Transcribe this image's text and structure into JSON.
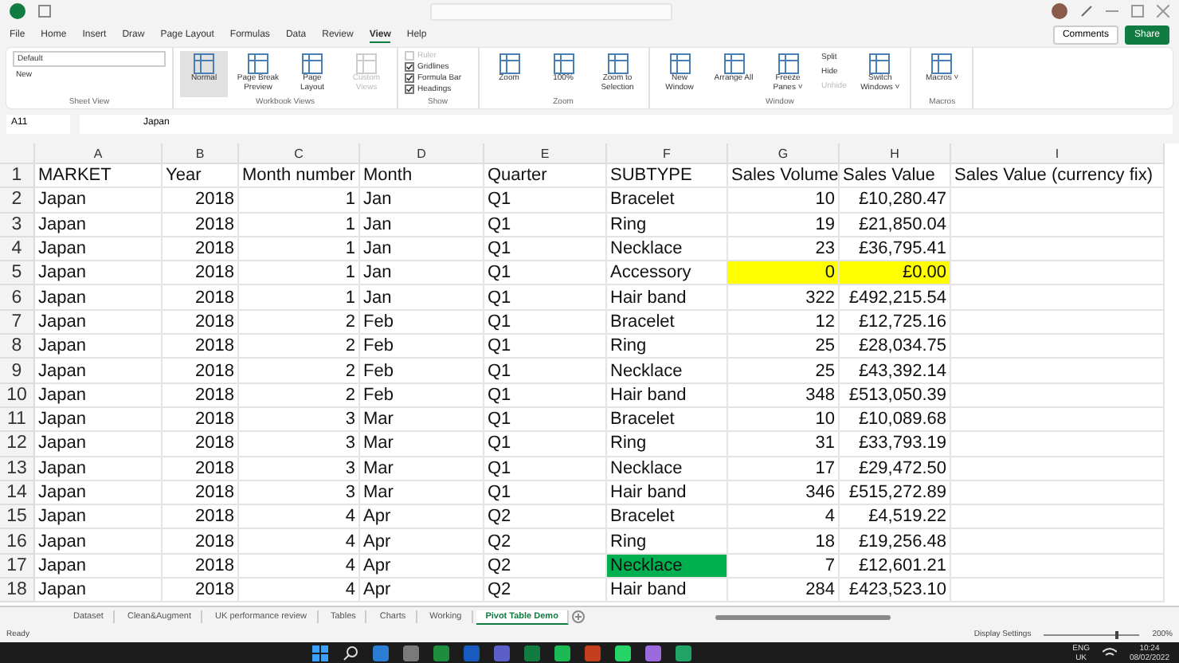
{
  "ribbon_tabs": [
    {
      "label": "File",
      "selected": false
    },
    {
      "label": "Home",
      "selected": false
    },
    {
      "label": "Insert",
      "selected": false
    },
    {
      "label": "Draw",
      "selected": false
    },
    {
      "label": "Page Layout",
      "selected": false
    },
    {
      "label": "Formulas",
      "selected": false
    },
    {
      "label": "Data",
      "selected": false
    },
    {
      "label": "Review",
      "selected": false
    },
    {
      "label": "View",
      "selected": true
    },
    {
      "label": "Help",
      "selected": false
    }
  ],
  "header_buttons": {
    "comments": "Comments",
    "share": "Share"
  },
  "ribbon_groups": [
    {
      "label": "Sheet View",
      "items": [
        {
          "kind": "dropdown",
          "label": "Default",
          "disabled": false
        },
        {
          "kind": "small",
          "label": "New",
          "disabled": false
        }
      ]
    },
    {
      "label": "Workbook Views",
      "items": [
        {
          "kind": "large",
          "label": "Normal",
          "disabled": false,
          "selected": true
        },
        {
          "kind": "large",
          "label": "Page Break Preview",
          "disabled": false,
          "selected": false
        },
        {
          "kind": "large",
          "label": "Page Layout",
          "disabled": false,
          "selected": false
        },
        {
          "kind": "large",
          "label": "Custom Views",
          "disabled": true,
          "selected": false
        }
      ]
    },
    {
      "label": "Show",
      "items": [
        {
          "kind": "check",
          "label": "Ruler",
          "disabled": true,
          "checked": false
        },
        {
          "kind": "check",
          "label": "Gridlines",
          "disabled": false,
          "checked": true
        },
        {
          "kind": "check",
          "label": "Formula Bar",
          "disabled": false,
          "checked": true
        },
        {
          "kind": "check",
          "label": "Headings",
          "disabled": false,
          "checked": true
        }
      ]
    },
    {
      "label": "Zoom",
      "items": [
        {
          "kind": "large",
          "label": "Zoom",
          "disabled": false,
          "selected": false
        },
        {
          "kind": "large",
          "label": "100%",
          "disabled": false,
          "selected": false
        },
        {
          "kind": "large",
          "label": "Zoom to Selection",
          "disabled": false,
          "selected": false
        }
      ]
    },
    {
      "label": "Window",
      "items": [
        {
          "kind": "large",
          "label": "New Window",
          "disabled": false,
          "selected": false
        },
        {
          "kind": "large",
          "label": "Arrange All",
          "disabled": false,
          "selected": false
        },
        {
          "kind": "large",
          "label": "Freeze Panes ˅",
          "disabled": false,
          "selected": false
        },
        {
          "kind": "small",
          "label": "Split",
          "disabled": false
        },
        {
          "kind": "small",
          "label": "Hide",
          "disabled": false
        },
        {
          "kind": "small",
          "label": "Unhide",
          "disabled": true
        },
        {
          "kind": "large",
          "label": "Switch Windows ˅",
          "disabled": false,
          "selected": false
        }
      ]
    },
    {
      "label": "Macros",
      "items": [
        {
          "kind": "large",
          "label": "Macros ˅",
          "disabled": false,
          "selected": false
        }
      ]
    }
  ],
  "formula_bar": {
    "name_box": "A11",
    "value": "Japan"
  },
  "columns": [
    {
      "label": "A",
      "kind": "text"
    },
    {
      "label": "B",
      "kind": "number"
    },
    {
      "label": "C",
      "kind": "number"
    },
    {
      "label": "D",
      "kind": "text"
    },
    {
      "label": "E",
      "kind": "text"
    },
    {
      "label": "F",
      "kind": "text"
    },
    {
      "label": "G",
      "kind": "number"
    },
    {
      "label": "H",
      "kind": "number"
    },
    {
      "label": "I",
      "kind": "text"
    }
  ],
  "rows": [
    {
      "number": "1",
      "kind": "header",
      "cells": [
        {
          "text": "MARKET"
        },
        {
          "text": "Year"
        },
        {
          "text": "Month number"
        },
        {
          "text": "Month"
        },
        {
          "text": "Quarter"
        },
        {
          "text": "SUBTYPE"
        },
        {
          "text": "Sales Volume"
        },
        {
          "text": "Sales Value"
        },
        {
          "text": "Sales Value (currency fix)"
        }
      ]
    },
    {
      "number": "2",
      "kind": "data",
      "cells": [
        {
          "text": "Japan"
        },
        {
          "text": "2018"
        },
        {
          "text": "1"
        },
        {
          "text": "Jan"
        },
        {
          "text": "Q1"
        },
        {
          "text": "Bracelet"
        },
        {
          "text": "10"
        },
        {
          "text": "£10,280.47"
        },
        {
          "text": ""
        }
      ]
    },
    {
      "number": "3",
      "kind": "data",
      "cells": [
        {
          "text": "Japan"
        },
        {
          "text": "2018"
        },
        {
          "text": "1"
        },
        {
          "text": "Jan"
        },
        {
          "text": "Q1"
        },
        {
          "text": "Ring"
        },
        {
          "text": "19"
        },
        {
          "text": "£21,850.04"
        },
        {
          "text": ""
        }
      ]
    },
    {
      "number": "4",
      "kind": "data",
      "cells": [
        {
          "text": "Japan"
        },
        {
          "text": "2018"
        },
        {
          "text": "1"
        },
        {
          "text": "Jan"
        },
        {
          "text": "Q1"
        },
        {
          "text": "Necklace"
        },
        {
          "text": "23"
        },
        {
          "text": "£36,795.41"
        },
        {
          "text": ""
        }
      ]
    },
    {
      "number": "5",
      "kind": "data",
      "cells": [
        {
          "text": "Japan"
        },
        {
          "text": "2018"
        },
        {
          "text": "1"
        },
        {
          "text": "Jan"
        },
        {
          "text": "Q1"
        },
        {
          "text": "Accessory"
        },
        {
          "text": "0",
          "color": "#ffff00"
        },
        {
          "text": "£0.00",
          "color": "#ffff00"
        },
        {
          "text": ""
        }
      ]
    },
    {
      "number": "6",
      "kind": "data",
      "cells": [
        {
          "text": "Japan"
        },
        {
          "text": "2018"
        },
        {
          "text": "1"
        },
        {
          "text": "Jan"
        },
        {
          "text": "Q1"
        },
        {
          "text": "Hair band"
        },
        {
          "text": "322"
        },
        {
          "text": "£492,215.54"
        },
        {
          "text": ""
        }
      ]
    },
    {
      "number": "7",
      "kind": "data",
      "cells": [
        {
          "text": "Japan"
        },
        {
          "text": "2018"
        },
        {
          "text": "2"
        },
        {
          "text": "Feb"
        },
        {
          "text": "Q1"
        },
        {
          "text": "Bracelet"
        },
        {
          "text": "12"
        },
        {
          "text": "£12,725.16"
        },
        {
          "text": ""
        }
      ]
    },
    {
      "number": "8",
      "kind": "data",
      "cells": [
        {
          "text": "Japan"
        },
        {
          "text": "2018"
        },
        {
          "text": "2"
        },
        {
          "text": "Feb"
        },
        {
          "text": "Q1"
        },
        {
          "text": "Ring"
        },
        {
          "text": "25"
        },
        {
          "text": "£28,034.75"
        },
        {
          "text": ""
        }
      ]
    },
    {
      "number": "9",
      "kind": "data",
      "cells": [
        {
          "text": "Japan"
        },
        {
          "text": "2018"
        },
        {
          "text": "2"
        },
        {
          "text": "Feb"
        },
        {
          "text": "Q1"
        },
        {
          "text": "Necklace"
        },
        {
          "text": "25"
        },
        {
          "text": "£43,392.14"
        },
        {
          "text": ""
        }
      ]
    },
    {
      "number": "10",
      "kind": "data",
      "cells": [
        {
          "text": "Japan"
        },
        {
          "text": "2018"
        },
        {
          "text": "2"
        },
        {
          "text": "Feb"
        },
        {
          "text": "Q1"
        },
        {
          "text": "Hair band"
        },
        {
          "text": "348"
        },
        {
          "text": "£513,050.39"
        },
        {
          "text": ""
        }
      ]
    },
    {
      "number": "11",
      "kind": "data",
      "cells": [
        {
          "text": "Japan"
        },
        {
          "text": "2018"
        },
        {
          "text": "3"
        },
        {
          "text": "Mar"
        },
        {
          "text": "Q1"
        },
        {
          "text": "Bracelet"
        },
        {
          "text": "10"
        },
        {
          "text": "£10,089.68"
        },
        {
          "text": ""
        }
      ]
    },
    {
      "number": "12",
      "kind": "data",
      "cells": [
        {
          "text": "Japan"
        },
        {
          "text": "2018"
        },
        {
          "text": "3"
        },
        {
          "text": "Mar"
        },
        {
          "text": "Q1"
        },
        {
          "text": "Ring"
        },
        {
          "text": "31"
        },
        {
          "text": "£33,793.19"
        },
        {
          "text": ""
        }
      ]
    },
    {
      "number": "13",
      "kind": "data",
      "cells": [
        {
          "text": "Japan"
        },
        {
          "text": "2018"
        },
        {
          "text": "3"
        },
        {
          "text": "Mar"
        },
        {
          "text": "Q1"
        },
        {
          "text": "Necklace"
        },
        {
          "text": "17"
        },
        {
          "text": "£29,472.50"
        },
        {
          "text": ""
        }
      ]
    },
    {
      "number": "14",
      "kind": "data",
      "cells": [
        {
          "text": "Japan"
        },
        {
          "text": "2018"
        },
        {
          "text": "3"
        },
        {
          "text": "Mar"
        },
        {
          "text": "Q1"
        },
        {
          "text": "Hair band"
        },
        {
          "text": "346"
        },
        {
          "text": "£515,272.89"
        },
        {
          "text": ""
        }
      ]
    },
    {
      "number": "15",
      "kind": "data",
      "cells": [
        {
          "text": "Japan"
        },
        {
          "text": "2018"
        },
        {
          "text": "4"
        },
        {
          "text": "Apr"
        },
        {
          "text": "Q2"
        },
        {
          "text": "Bracelet"
        },
        {
          "text": "4"
        },
        {
          "text": "£4,519.22"
        },
        {
          "text": ""
        }
      ]
    },
    {
      "number": "16",
      "kind": "data",
      "cells": [
        {
          "text": "Japan"
        },
        {
          "text": "2018"
        },
        {
          "text": "4"
        },
        {
          "text": "Apr"
        },
        {
          "text": "Q2"
        },
        {
          "text": "Ring"
        },
        {
          "text": "18"
        },
        {
          "text": "£19,256.48"
        },
        {
          "text": ""
        }
      ]
    },
    {
      "number": "17",
      "kind": "data",
      "cells": [
        {
          "text": "Japan"
        },
        {
          "text": "2018"
        },
        {
          "text": "4"
        },
        {
          "text": "Apr"
        },
        {
          "text": "Q2"
        },
        {
          "text": "Necklace",
          "color": "#00b050"
        },
        {
          "text": "7"
        },
        {
          "text": "£12,601.21"
        },
        {
          "text": ""
        }
      ]
    },
    {
      "number": "18",
      "kind": "data",
      "cells": [
        {
          "text": "Japan"
        },
        {
          "text": "2018"
        },
        {
          "text": "4"
        },
        {
          "text": "Apr"
        },
        {
          "text": "Q2"
        },
        {
          "text": "Hair band"
        },
        {
          "text": "284"
        },
        {
          "text": "£423,523.10"
        },
        {
          "text": ""
        }
      ]
    }
  ],
  "sheet_tabs": [
    {
      "label": "Dataset",
      "selected": false
    },
    {
      "label": "Clean&Augment",
      "selected": false
    },
    {
      "label": "UK performance review",
      "selected": false
    },
    {
      "label": "Tables",
      "selected": false
    },
    {
      "label": "Charts",
      "selected": false
    },
    {
      "label": "Working",
      "selected": false
    },
    {
      "label": "Pivot Table Demo",
      "selected": true
    }
  ],
  "status_bar": {
    "status": "Ready",
    "display_settings": "Display Settings",
    "zoom": "200%",
    "level": 0.75
  },
  "taskbar": {
    "language": "ENG",
    "region": "UK",
    "time": "10:24",
    "date": "08/02/2022"
  }
}
